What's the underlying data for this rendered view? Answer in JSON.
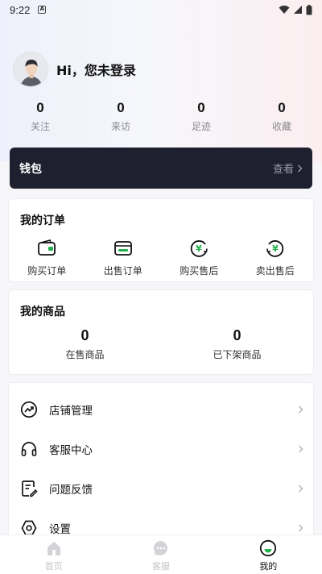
{
  "status_bar": {
    "time": "9:22"
  },
  "profile": {
    "greeting": "Hi，您未登录"
  },
  "stats": [
    {
      "value": "0",
      "label": "关注"
    },
    {
      "value": "0",
      "label": "来访"
    },
    {
      "value": "0",
      "label": "足迹"
    },
    {
      "value": "0",
      "label": "收藏"
    }
  ],
  "wallet": {
    "title": "钱包",
    "view": "查看"
  },
  "orders": {
    "title": "我的订单",
    "items": [
      {
        "label": "购买订单",
        "icon": "wallet-icon"
      },
      {
        "label": "出售订单",
        "icon": "card-icon"
      },
      {
        "label": "购买售后",
        "icon": "yen-refund-icon"
      },
      {
        "label": "卖出售后",
        "icon": "yen-return-icon"
      }
    ]
  },
  "goods": {
    "title": "我的商品",
    "items": [
      {
        "value": "0",
        "label": "在售商品"
      },
      {
        "value": "0",
        "label": "已下架商品"
      }
    ]
  },
  "menu": [
    {
      "label": "店铺管理",
      "icon": "trend-icon"
    },
    {
      "label": "客服中心",
      "icon": "headset-icon"
    },
    {
      "label": "问题反馈",
      "icon": "feedback-icon"
    },
    {
      "label": "设置",
      "icon": "settings-icon"
    }
  ],
  "tabbar": [
    {
      "label": "首页",
      "icon": "home-icon",
      "active": false
    },
    {
      "label": "客服",
      "icon": "chat-icon",
      "active": false
    },
    {
      "label": "我的",
      "icon": "profile-icon",
      "active": true
    }
  ],
  "colors": {
    "accent": "#22b14c",
    "wallet_bg": "#1e1f2f"
  }
}
